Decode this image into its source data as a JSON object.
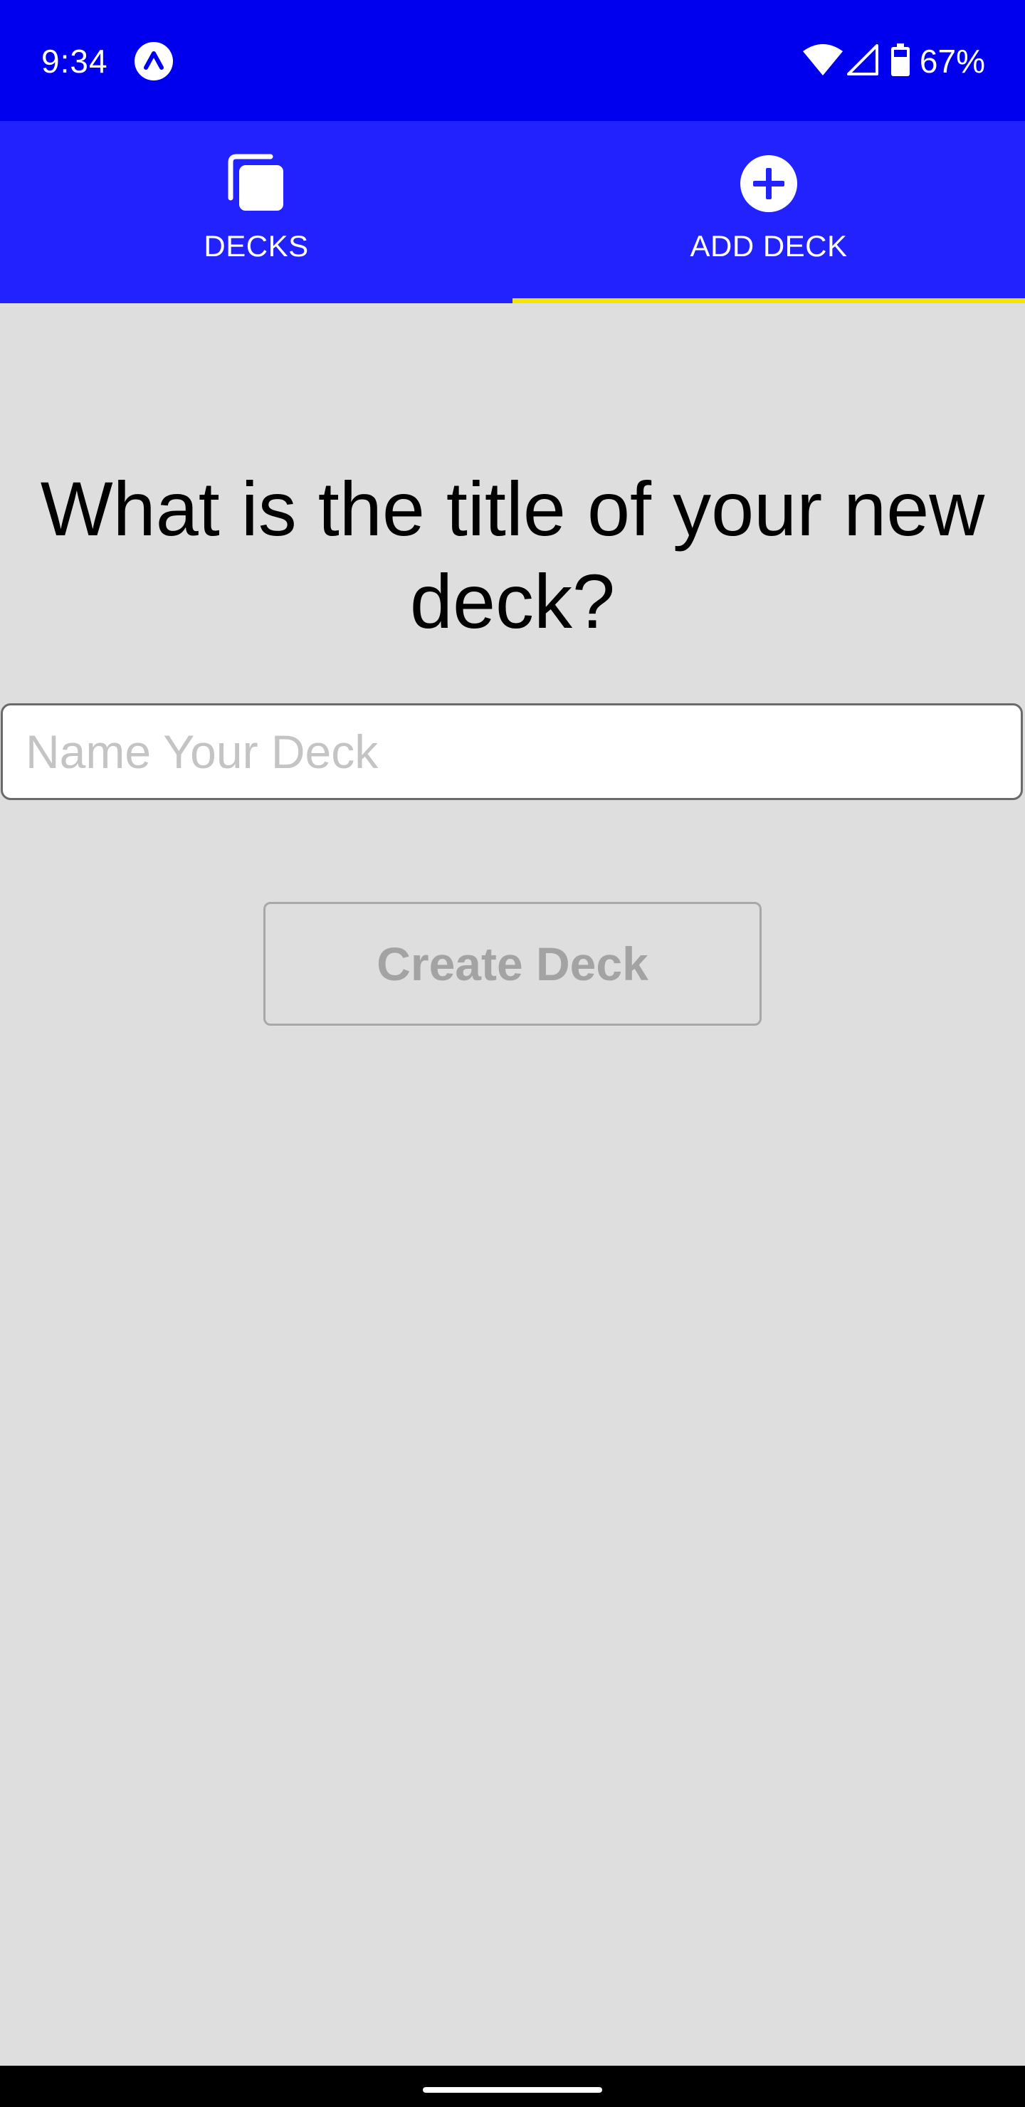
{
  "status_bar": {
    "time": "9:34",
    "battery": "67%",
    "app_icon": "expo-icon",
    "wifi_icon": "wifi-icon",
    "signal_icon": "cell-signal-icon",
    "battery_icon": "battery-icon",
    "background": "#0000ee"
  },
  "tabs": [
    {
      "label": "DECKS",
      "icon": "decks-icon",
      "active": false
    },
    {
      "label": "ADD DECK",
      "icon": "add-circle-icon",
      "active": true
    }
  ],
  "tab_bar": {
    "background": "#2222ff",
    "indicator_color": "#f2e600"
  },
  "form": {
    "question": "What is the title of your new deck?",
    "input_placeholder": "Name Your Deck",
    "input_value": "",
    "button_label": "Create Deck"
  }
}
